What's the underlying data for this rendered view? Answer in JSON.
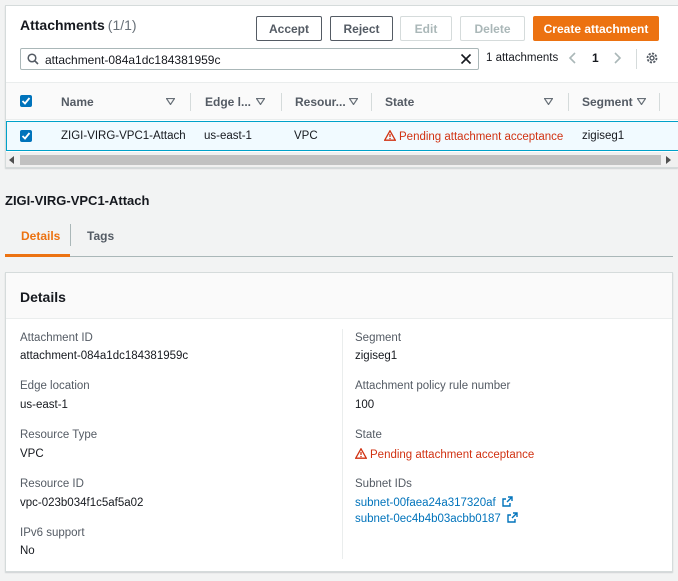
{
  "attachments": {
    "title": "Attachments",
    "count": "(1/1)",
    "buttons": {
      "accept": "Accept",
      "reject": "Reject",
      "edit": "Edit",
      "delete": "Delete",
      "create": "Create attachment"
    },
    "search": {
      "value": "attachment-084a1dc184381959c"
    },
    "pager": {
      "count_label": "1 attachments",
      "page": "1"
    },
    "columns": [
      "Name",
      "Edge l...",
      "Resour...",
      "State",
      "Segment"
    ],
    "rows": [
      {
        "name": "ZIGI-VIRG-VPC1-Attach",
        "edge": "us-east-1",
        "resource": "VPC",
        "state": "Pending attachment acceptance",
        "segment": "zigiseg1"
      }
    ]
  },
  "detail": {
    "title": "ZIGI-VIRG-VPC1-Attach",
    "tabs": [
      "Details",
      "Tags"
    ],
    "panel_title": "Details",
    "left": [
      {
        "key": "Attachment ID",
        "value": "attachment-084a1dc184381959c"
      },
      {
        "key": "Edge location",
        "value": "us-east-1"
      },
      {
        "key": "Resource Type",
        "value": "VPC"
      },
      {
        "key": "Resource ID",
        "value": "vpc-023b034f1c5af5a02"
      },
      {
        "key": "IPv6 support",
        "value": "No"
      }
    ],
    "right": {
      "segment": {
        "key": "Segment",
        "value": "zigiseg1"
      },
      "policy": {
        "key": "Attachment policy rule number",
        "value": "100"
      },
      "state": {
        "key": "State",
        "value": "Pending attachment acceptance"
      },
      "subnets": {
        "key": "Subnet IDs",
        "values": [
          "subnet-00faea24a317320af",
          "subnet-0ec4b4b03acbb0187"
        ]
      }
    }
  },
  "colors": {
    "accent": "#ec7211",
    "link": "#0073bb",
    "warning": "#d13212",
    "selected_bg": "#f1faff"
  }
}
